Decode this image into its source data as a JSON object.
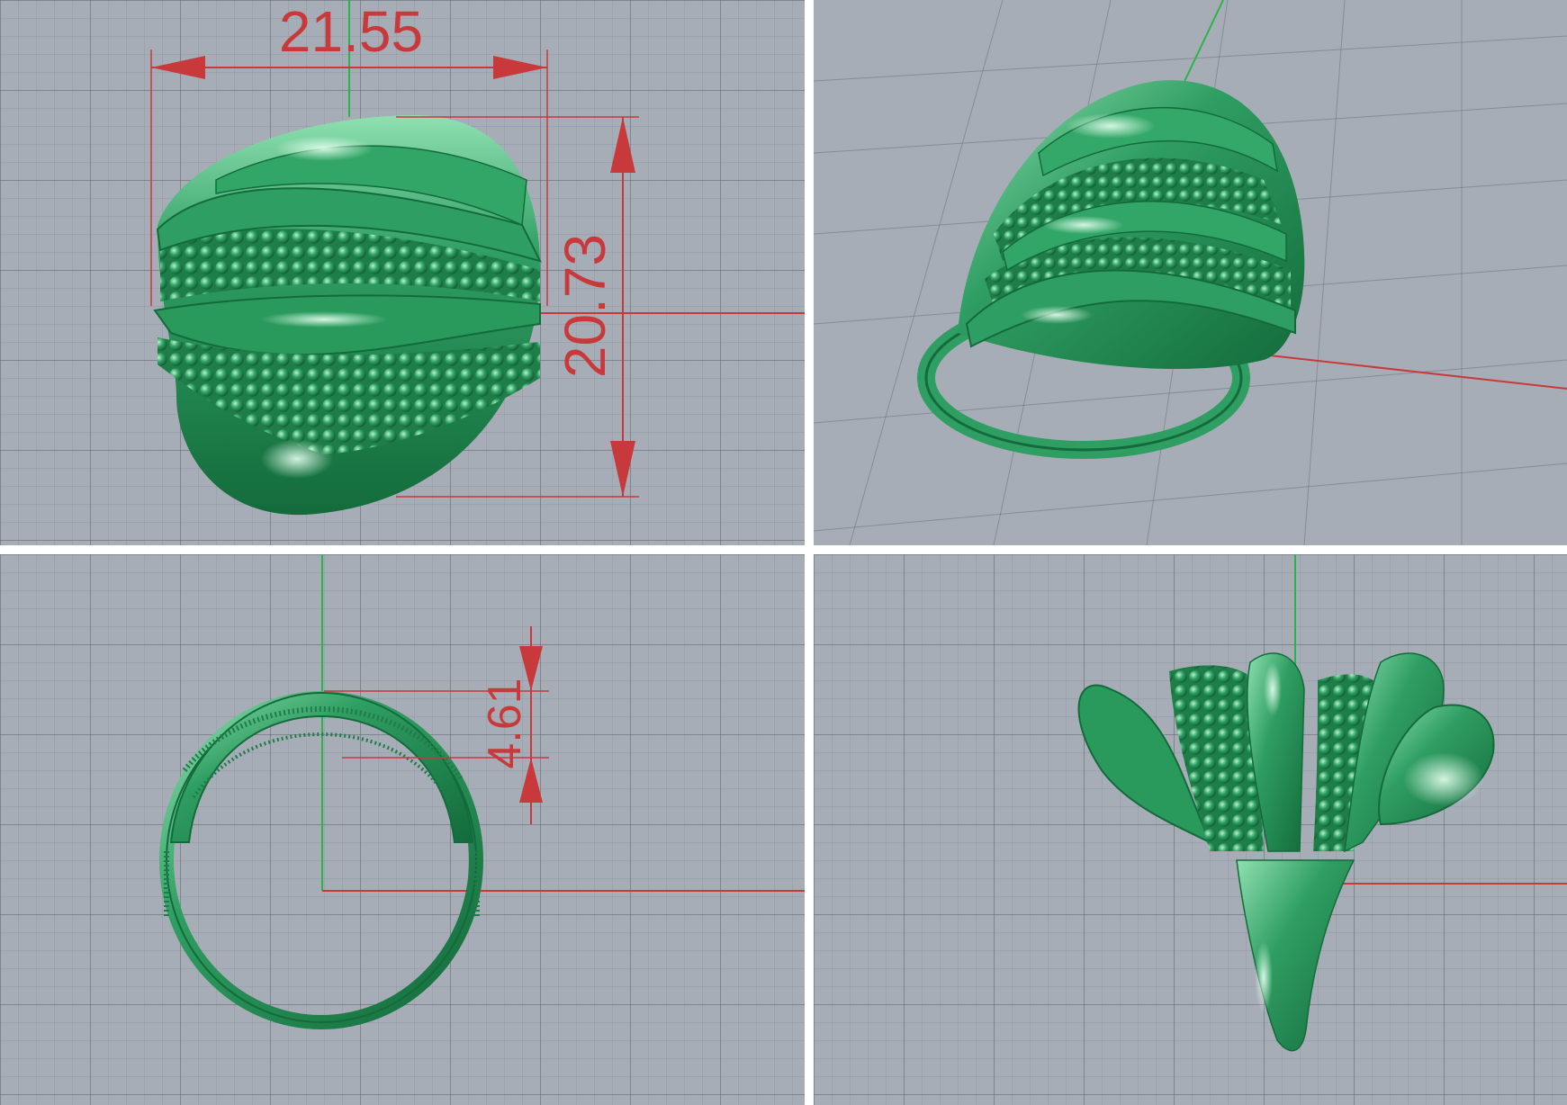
{
  "viewports": [
    {
      "id": "top",
      "dimensions": [
        {
          "value": "21.55",
          "orientation": "horizontal"
        },
        {
          "value": "20.73",
          "orientation": "vertical"
        }
      ]
    },
    {
      "id": "perspective",
      "dimensions": []
    },
    {
      "id": "front",
      "dimensions": [
        {
          "value": "4.61",
          "orientation": "vertical"
        }
      ]
    },
    {
      "id": "right",
      "dimensions": []
    }
  ],
  "colors": {
    "viewport_bg": "#a7adb7",
    "grid_line": "#4c5058",
    "model_green": "#2f9e62",
    "model_highlight": "#8fe0b1",
    "model_shadow": "#136b3b",
    "dimension_red": "#c8393b",
    "axis_x_red": "#c8393b",
    "axis_y_green": "#2bb34a"
  }
}
